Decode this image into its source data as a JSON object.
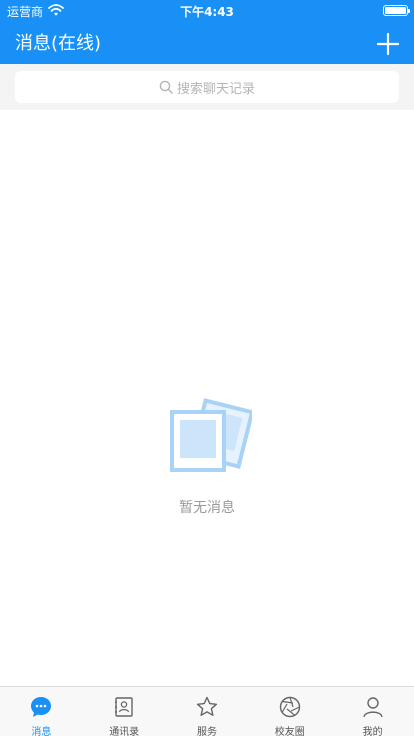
{
  "status_bar": {
    "carrier": "运营商",
    "time": "下午4:43"
  },
  "header": {
    "title": "消息(在线)"
  },
  "search": {
    "placeholder": "搜索聊天记录"
  },
  "empty_state": {
    "text": "暂无消息"
  },
  "tabs": [
    {
      "label": "消息",
      "icon": "chat-bubble-icon",
      "active": true
    },
    {
      "label": "通讯录",
      "icon": "contacts-icon",
      "active": false
    },
    {
      "label": "服务",
      "icon": "star-icon",
      "active": false
    },
    {
      "label": "校友圈",
      "icon": "aperture-icon",
      "active": false
    },
    {
      "label": "我的",
      "icon": "person-icon",
      "active": false
    }
  ],
  "colors": {
    "primary": "#1890f5",
    "search_bg": "#f4f4f4",
    "tabbar_bg": "#f8f8f8"
  }
}
